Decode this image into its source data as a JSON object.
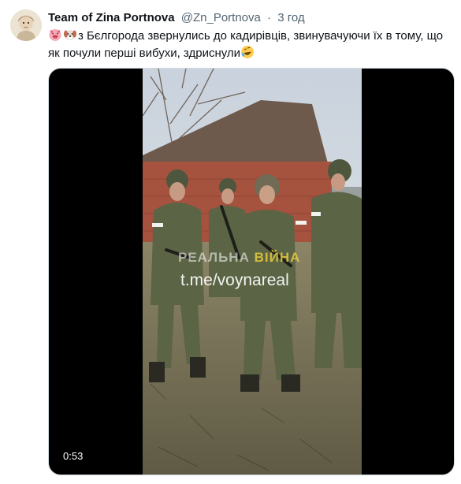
{
  "tweet": {
    "display_name": "Team of Zina Portnova",
    "handle": "@Zn_Portnova",
    "separator": "·",
    "time": "3 год",
    "emojis": [
      "pig-face-emoji",
      "dog-face-emoji",
      "rolling-on-floor-laughing-emoji"
    ],
    "text": "з Бєлгорода звернулись до кадирівців, звинувачуючи їх в тому, що як почули перші вибухи, здриснули"
  },
  "media": {
    "watermark_left": "РЕАЛЬНА",
    "watermark_right": "ВІЙНА",
    "watermark_link": "t.me/voynareal",
    "duration": "0:53"
  },
  "colors": {
    "text_primary": "#0f1419",
    "text_secondary": "#536471",
    "media_background": "#000000",
    "border": "#cfd9de"
  }
}
